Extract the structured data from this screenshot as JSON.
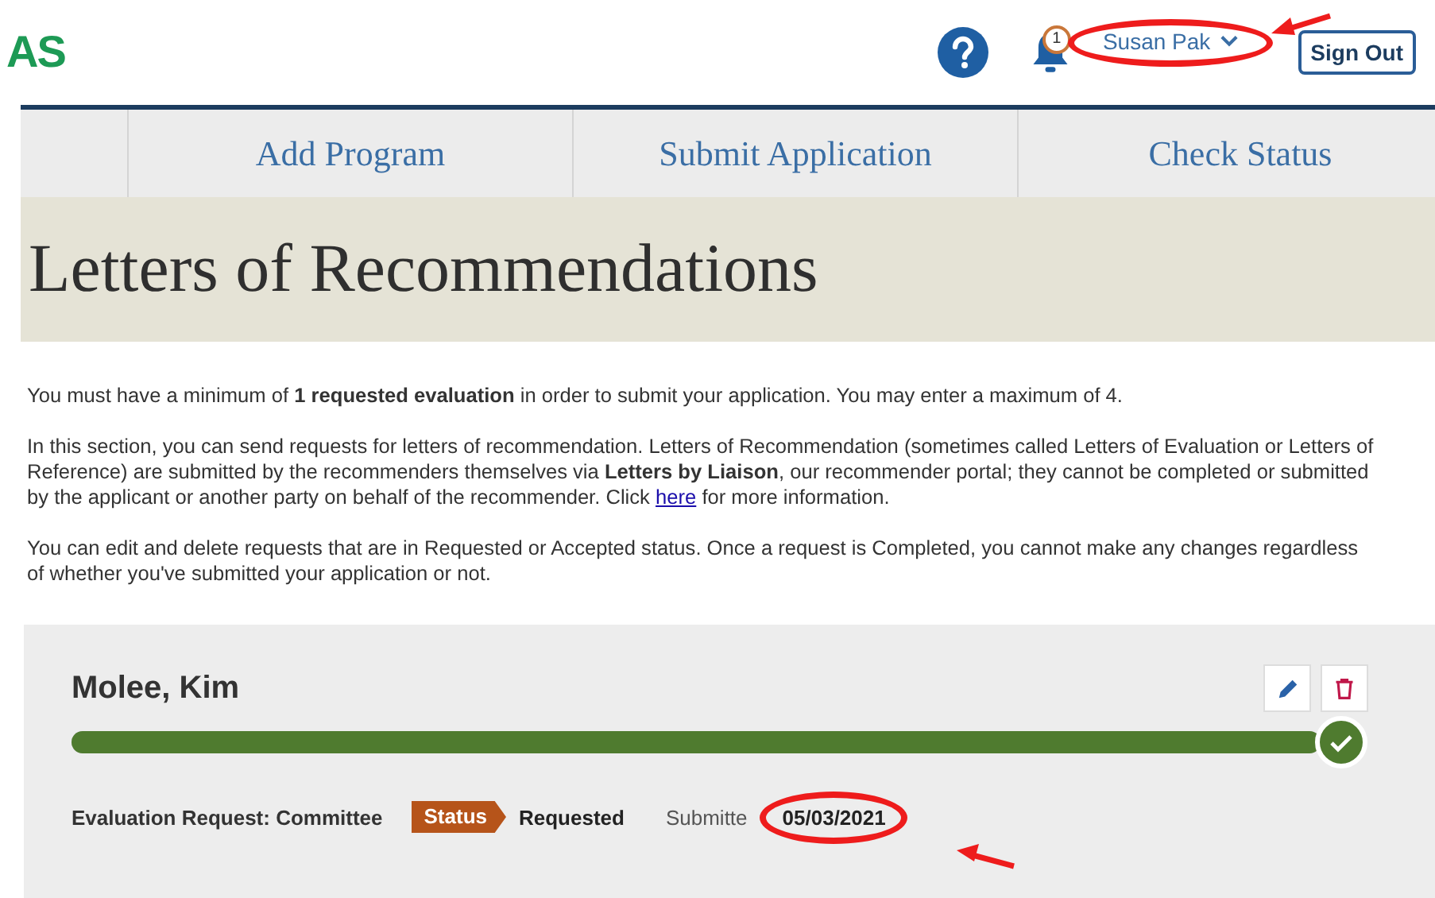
{
  "header": {
    "logo": "AS",
    "notification_count": "1",
    "user_name": "Susan Pak",
    "sign_out": "Sign Out"
  },
  "nav_tabs": [
    {
      "label": "Add Program"
    },
    {
      "label": "Submit Application"
    },
    {
      "label": "Check Status"
    }
  ],
  "page_title": "Letters of Recommendations",
  "paragraphs": [
    {
      "text": "You must have a minimum of **1 requested evaluation** in order to submit your application. You may enter a maximum of 4."
    },
    {
      "text": "In this section, you can send requests for letters of recommendation.  Letters of Recommendation (sometimes called Letters of Evaluation or Letters of Reference) are submitted by the recommenders themselves via **Letters by Liaison**, our recommender portal; they cannot be completed or submitted by the applicant or another party on behalf of the recommender.  Click",
      "link": "here",
      "after": "for more information."
    },
    {
      "text": "You can edit and delete requests that are in Requested or Accepted status.  Once a request is Completed, you cannot make any changes regardless of whether you've submitted your application or not."
    }
  ],
  "recommenders": [
    {
      "name": "Molee, Kim",
      "level": 1,
      "completed": true,
      "evaluation": "Evaluation Request: Committee",
      "status_label": "Status",
      "status": "Requested",
      "submitted_label": "Submitte",
      "submitted_date": "05/03/2021"
    }
  ]
}
